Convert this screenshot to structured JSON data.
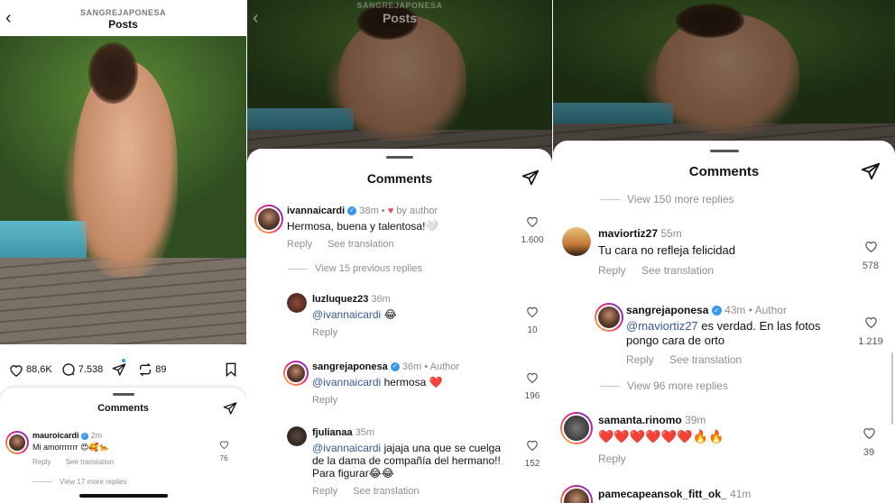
{
  "colors": {
    "accent": "#3897f0",
    "like_red": "#ed4956",
    "mention": "#385898",
    "muted": "#8e8e8e"
  },
  "panel1": {
    "header": {
      "username": "SANGREJAPONESA",
      "title": "Posts"
    },
    "stats": {
      "likes": "88,6K",
      "comments": "7.538",
      "reposts": "89"
    },
    "sheet": {
      "title": "Comments",
      "comment": {
        "user": "mauroicardi",
        "time": "2m",
        "text": "Mi amorrrrrrr 😍🥰🐆",
        "reply": "Reply",
        "translate": "See translation",
        "likes": "76"
      },
      "view_more": "View 17 more replies"
    }
  },
  "panel2": {
    "header": {
      "username": "SANGREJAPONESA",
      "title": "Posts"
    },
    "sheet_title": "Comments",
    "comments": [
      {
        "user": "ivannaicardi",
        "time": "38m",
        "badge": "by author",
        "text": "Hermosa, buena y talentosa!🤍",
        "reply": "Reply",
        "translate": "See translation",
        "likes": "1.600"
      },
      {
        "user": "luzluquez23",
        "time": "36m",
        "mention": "@ivannaicardi",
        "text": "😂",
        "reply": "Reply",
        "likes": "10"
      },
      {
        "user": "sangrejaponesa",
        "time": "36m",
        "author": "Author",
        "mention": "@ivannaicardi",
        "text": "hermosa ❤️",
        "reply": "Reply",
        "likes": "196"
      },
      {
        "user": "fjulianaa",
        "time": "35m",
        "mention": "@ivannaicardi",
        "text_line1": "jajaja una que se cuelga",
        "text_line2": "de la dama de compañía del hermano!!",
        "text_line3": "Para figurar😂😂",
        "reply": "Reply",
        "translate": "See translation",
        "likes": "152"
      }
    ],
    "view_previous": "View 15 previous replies"
  },
  "panel3": {
    "sheet_title": "Comments",
    "view_150": "View 150 more replies",
    "comments": [
      {
        "user": "maviortiz27",
        "time": "55m",
        "text": "Tu cara no refleja felicidad",
        "reply": "Reply",
        "translate": "See translation",
        "likes": "578"
      },
      {
        "user": "sangrejaponesa",
        "time": "43m",
        "author": "Author",
        "mention": "@maviortiz27",
        "text_line1": "es verdad. En las fotos",
        "text_line2": "pongo cara de orto",
        "reply": "Reply",
        "translate": "See translation",
        "likes": "1.219"
      },
      {
        "user": "samanta.rinomo",
        "time": "39m",
        "text": "❤️❤️❤️❤️❤️❤️🔥🔥",
        "reply": "Reply",
        "likes": "39"
      },
      {
        "user": "pamecapeansok_fitt_ok_",
        "time": "41m"
      }
    ],
    "view_96": "View 96 more replies"
  }
}
